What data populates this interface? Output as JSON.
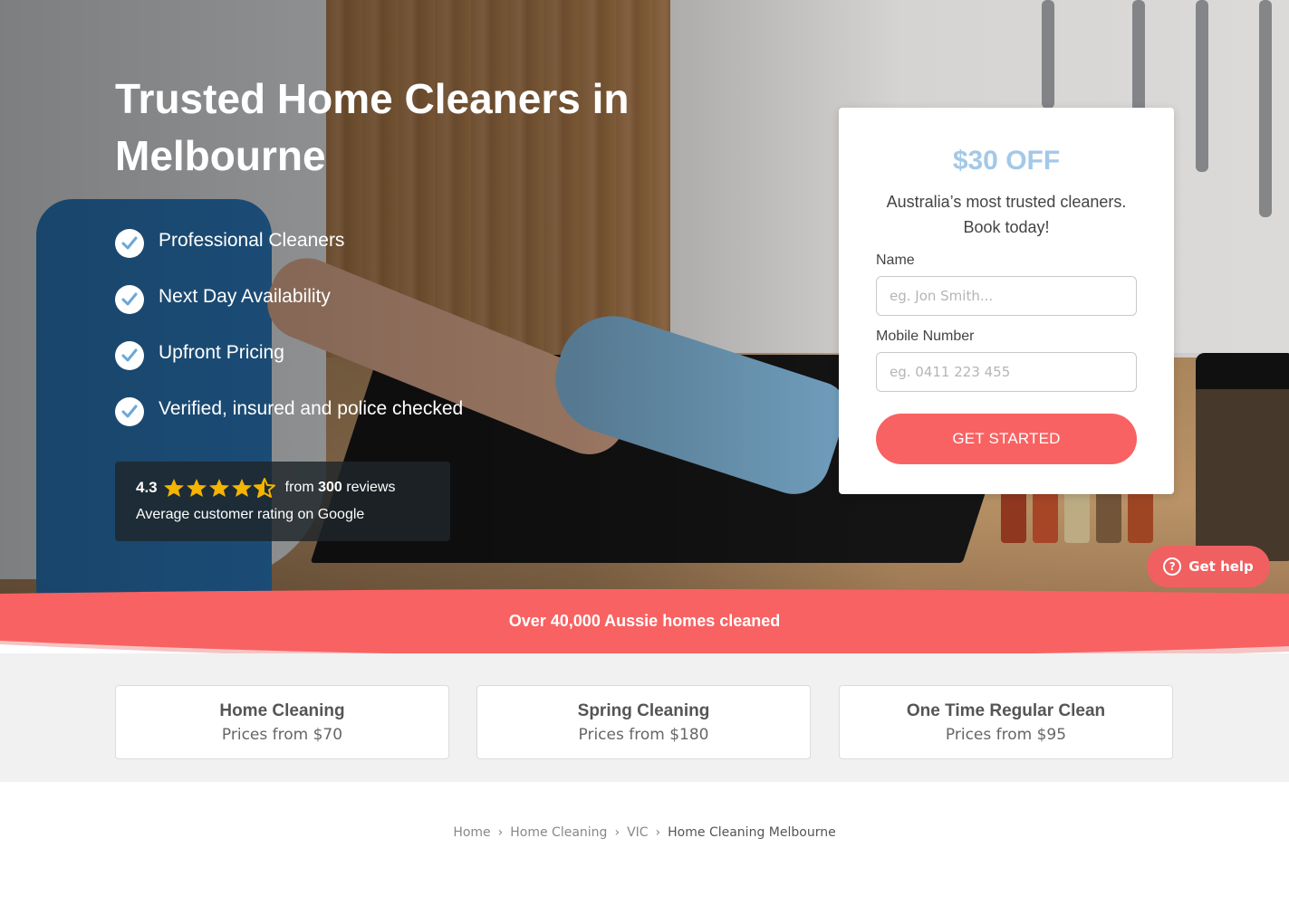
{
  "hero": {
    "title": "Trusted Home Cleaners in Melbourne",
    "features": [
      "Professional Cleaners",
      "Next Day Availability",
      "Upfront Pricing",
      "Verified, insured and police checked"
    ],
    "rating": {
      "score": "4.3",
      "stars": 4.5,
      "from_prefix": "from",
      "review_count": "300",
      "from_suffix": "reviews",
      "subtitle": "Average customer rating on Google"
    }
  },
  "form": {
    "offer": "$30 OFF",
    "tagline": "Australia’s most trusted cleaners. Book today!",
    "name_label": "Name",
    "name_placeholder": "eg. Jon Smith...",
    "mobile_label": "Mobile Number",
    "mobile_placeholder": "eg. 0411 223 455",
    "cta_label": "GET STARTED"
  },
  "help": {
    "icon": "question-circle-icon",
    "label": "Get help"
  },
  "banner": {
    "text": "Over 40,000 Aussie homes cleaned"
  },
  "prices": [
    {
      "title": "Home Cleaning",
      "subtitle": "Prices from $70"
    },
    {
      "title": "Spring Cleaning",
      "subtitle": "Prices from $180"
    },
    {
      "title": "One Time Regular Clean",
      "subtitle": "Prices from $95"
    }
  ],
  "breadcrumb": {
    "items": [
      "Home",
      "Home Cleaning",
      "VIC"
    ],
    "current": "Home Cleaning Melbourne",
    "separator": "›"
  },
  "colors": {
    "accent": "#f96262",
    "offer": "#a3c8e8",
    "star": "#f5b400",
    "check": "#6aa7d8"
  }
}
